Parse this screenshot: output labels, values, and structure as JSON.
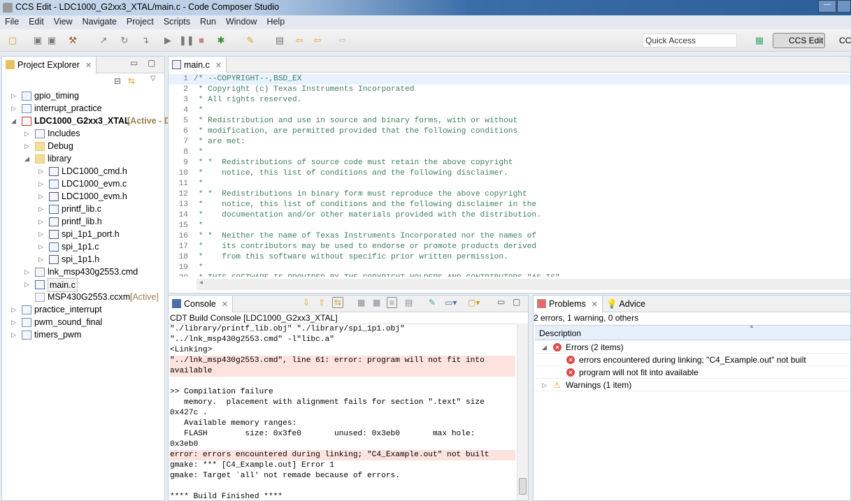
{
  "window": {
    "title": "CCS Edit - LDC1000_G2xx3_XTAL/main.c - Code Composer Studio"
  },
  "menu": [
    "File",
    "Edit",
    "View",
    "Navigate",
    "Project",
    "Scripts",
    "Run",
    "Window",
    "Help"
  ],
  "toolbar": {
    "quick_access_placeholder": "Quick Access",
    "perspective_active": "CCS Edit",
    "perspective_other": "CC"
  },
  "explorer": {
    "title": "Project Explorer",
    "items": [
      {
        "label": "gpio_timing",
        "level": 0,
        "expanded": false,
        "icon": "ccs-project-icon"
      },
      {
        "label": "interrupt_practice",
        "level": 0,
        "expanded": false,
        "icon": "ccs-project-warning-icon"
      },
      {
        "label": "LDC1000_G2xx3_XTAL",
        "suffix": "[Active - Debug]",
        "level": 0,
        "expanded": true,
        "bold": true,
        "icon": "c-project-error-icon"
      },
      {
        "label": "Includes",
        "level": 1,
        "expanded": false,
        "icon": "includes-icon"
      },
      {
        "label": "Debug",
        "level": 1,
        "expanded": false,
        "icon": "folder-icon"
      },
      {
        "label": "library",
        "level": 1,
        "expanded": true,
        "icon": "folder-icon"
      },
      {
        "label": "LDC1000_cmd.h",
        "level": 2,
        "expanded": false,
        "icon": "header-file-icon"
      },
      {
        "label": "LDC1000_evm.c",
        "level": 2,
        "expanded": false,
        "icon": "c-file-icon"
      },
      {
        "label": "LDC1000_evm.h",
        "level": 2,
        "expanded": false,
        "icon": "header-file-icon"
      },
      {
        "label": "printf_lib.c",
        "level": 2,
        "expanded": false,
        "icon": "c-file-icon"
      },
      {
        "label": "printf_lib.h",
        "level": 2,
        "expanded": false,
        "icon": "header-file-icon"
      },
      {
        "label": "spi_1p1_port.h",
        "level": 2,
        "expanded": false,
        "icon": "header-file-icon"
      },
      {
        "label": "spi_1p1.c",
        "level": 2,
        "expanded": false,
        "icon": "c-file-icon"
      },
      {
        "label": "spi_1p1.h",
        "level": 2,
        "expanded": false,
        "icon": "header-file-icon"
      },
      {
        "label": "lnk_msp430g2553.cmd",
        "level": 1,
        "expanded": false,
        "icon": "cmd-file-icon"
      },
      {
        "label": "main.c",
        "level": 1,
        "expanded": false,
        "icon": "c-file-icon",
        "selected": true
      },
      {
        "label": "MSP430G2553.ccxml",
        "suffix": "[Active]",
        "level": 1,
        "leaf": true,
        "icon": "ccxml-file-icon"
      },
      {
        "label": "practice_interrupt",
        "level": 0,
        "expanded": false,
        "icon": "ccs-project-icon"
      },
      {
        "label": "pwm_sound_final",
        "level": 0,
        "expanded": false,
        "icon": "ccs-project-icon"
      },
      {
        "label": "timers_pwm",
        "level": 0,
        "expanded": false,
        "icon": "ccs-project-icon"
      }
    ]
  },
  "editor": {
    "tab": "main.c",
    "lines": [
      "/* --COPYRIGHT--,BSD_EX",
      " * Copyright (c) Texas Instruments Incorporated",
      " * All rights reserved.",
      " *",
      " * Redistribution and use in source and binary forms, with or without",
      " * modification, are permitted provided that the following conditions",
      " * are met:",
      " *",
      " * *  Redistributions of source code must retain the above copyright",
      " *    notice, this list of conditions and the following disclaimer.",
      " *",
      " * *  Redistributions in binary form must reproduce the above copyright",
      " *    notice, this list of conditions and the following disclaimer in the",
      " *    documentation and/or other materials provided with the distribution.",
      " *",
      " * *  Neither the name of Texas Instruments Incorporated nor the names of",
      " *    its contributors may be used to endorse or promote products derived",
      " *    from this software without specific prior written permission.",
      " *",
      " * THIS SOFTWARE IS PROVIDED BY THE COPYRIGHT HOLDERS AND CONTRIBUTORS \"AS IS\""
    ]
  },
  "console": {
    "tab": "Console",
    "title": "CDT Build Console [LDC1000_G2xx3_XTAL]",
    "lines": [
      {
        "text": "\"./library/printf_lib.obj\" \"./library/spi_1p1.obj\""
      },
      {
        "text": "\"../lnk_msp430g2553.cmd\" -l\"libc.a\""
      },
      {
        "text": "<Linking>"
      },
      {
        "text": "\"../lnk_msp430g2553.cmd\", line 61: error: program will not fit into",
        "error": true
      },
      {
        "text": "available",
        "error": true
      },
      {
        "text": ""
      },
      {
        "text": ">> Compilation failure"
      },
      {
        "text": "   memory.  placement with alignment fails for section \".text\" size"
      },
      {
        "text": "0x427c ."
      },
      {
        "text": "   Available memory ranges:"
      },
      {
        "text": "   FLASH        size: 0x3fe0       unused: 0x3eb0       max hole:"
      },
      {
        "text": "0x3eb0"
      },
      {
        "text": "error: errors encountered during linking; \"C4_Example.out\" not built",
        "error": true
      },
      {
        "text": "gmake: *** [C4_Example.out] Error 1"
      },
      {
        "text": "gmake: Target `all' not remade because of errors."
      },
      {
        "text": ""
      },
      {
        "text": "**** Build Finished ****"
      }
    ]
  },
  "problems": {
    "tab": "Problems",
    "advice_tab": "Advice",
    "summary": "2 errors, 1 warning, 0 others",
    "column": "Description",
    "groups": [
      {
        "label": "Errors (2 items)",
        "expanded": true,
        "type": "error",
        "items": [
          "errors encountered during linking; \"C4_Example.out\" not built",
          "program will not fit into available"
        ]
      },
      {
        "label": "Warnings (1 item)",
        "expanded": false,
        "type": "warning",
        "items": []
      }
    ]
  },
  "colors": {
    "comment": "#3f7f5f",
    "error_bg": "#fde3dd",
    "active_suffix": "#a08050"
  }
}
